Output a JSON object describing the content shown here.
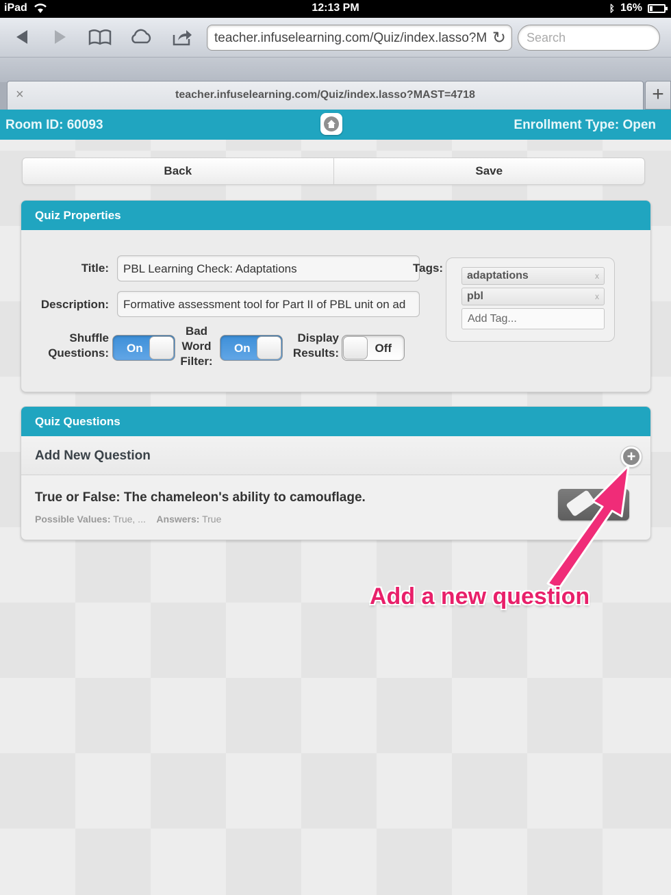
{
  "status_bar": {
    "device": "iPad",
    "time": "12:13 PM",
    "battery": "16%"
  },
  "browser": {
    "url": "teacher.infuselearning.com/Quiz/index.lasso?M",
    "search_placeholder": "Search",
    "tab_title": "teacher.infuselearning.com/Quiz/index.lasso?MAST=4718",
    "tab_close": "×",
    "new_tab": "+"
  },
  "app_header": {
    "room_label": "Room ID: 60093",
    "enrollment_label": "Enrollment Type: Open"
  },
  "actions": {
    "back_label": "Back",
    "save_label": "Save"
  },
  "quiz_properties": {
    "header": "Quiz Properties",
    "title_label": "Title:",
    "title_value": "PBL Learning Check: Adaptations",
    "description_label": "Description:",
    "description_value": "Formative assessment tool for Part II of PBL unit on ad",
    "shuffle_label_1": "Shuffle",
    "shuffle_label_2": "Questions:",
    "shuffle_state": "On",
    "badword_label_1": "Bad",
    "badword_label_2": "Word",
    "badword_label_3": "Filter:",
    "badword_state": "On",
    "display_label_1": "Display",
    "display_label_2": "Results:",
    "display_state": "Off",
    "tags_label": "Tags:",
    "tags": [
      "adaptations",
      "pbl"
    ],
    "tag_remove": "x",
    "add_tag_placeholder": "Add Tag..."
  },
  "quiz_questions": {
    "header": "Quiz Questions",
    "add_new_label": "Add New Question",
    "questions": [
      {
        "title": "True or False: The chameleon's ability to camouflage.",
        "possible_values_label": "Possible Values:",
        "possible_values": "True, ...",
        "answers_label": "Answers:",
        "answers": "True"
      }
    ]
  },
  "annotation": {
    "text": "Add a new question",
    "color": "#e8206a"
  },
  "colors": {
    "accent": "#20a5c0",
    "toggle_on": "#3d8fd8"
  }
}
